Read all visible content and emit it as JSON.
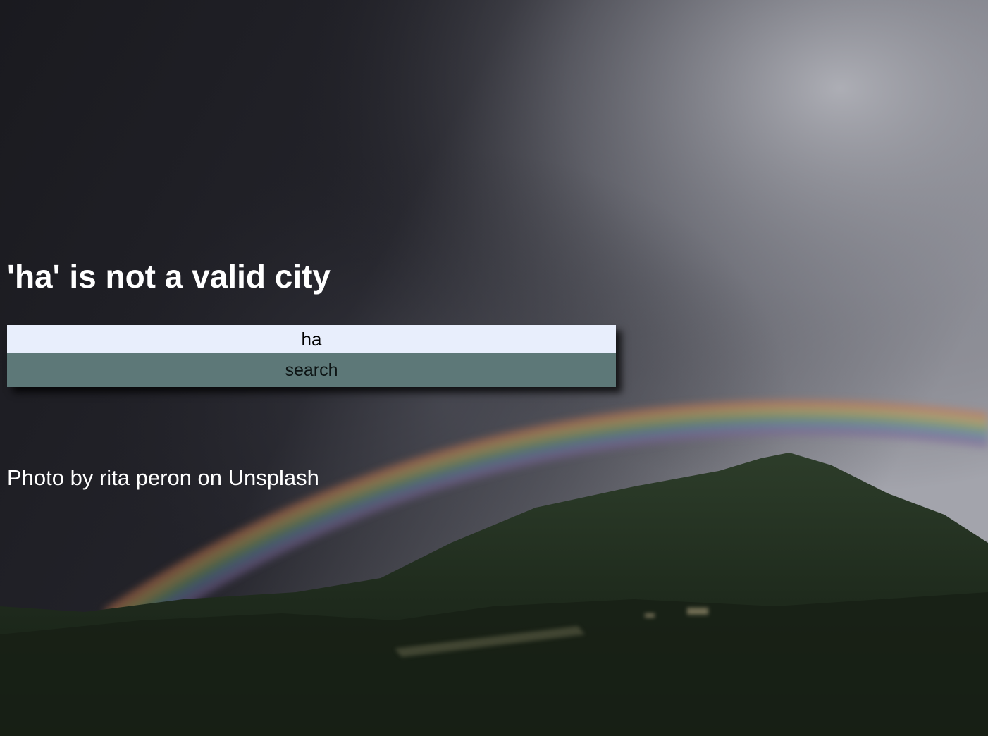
{
  "background": {
    "image": "stormy-sky-rainbow-forested-mountain-photo",
    "colors": {
      "sky_dark": "#1c1c22",
      "sky_light": "#9a9ba3",
      "forest": "#1e2a1c"
    }
  },
  "header": {
    "error_message": "'ha' is not a valid city"
  },
  "search": {
    "input_value": "ha",
    "button_label": "search",
    "input_bg": "#e8eefc",
    "button_bg": "#5d7878"
  },
  "footer": {
    "credit": "Photo by rita peron on Unsplash"
  }
}
